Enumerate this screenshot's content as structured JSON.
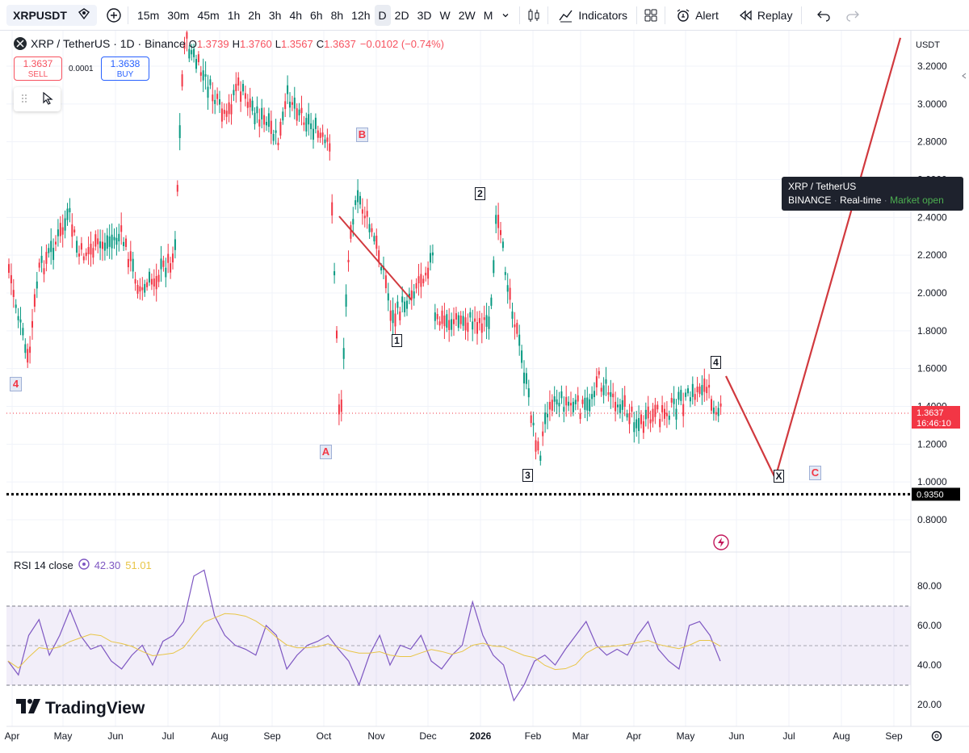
{
  "toolbar": {
    "symbol": "XRPUSDT",
    "intervals": [
      "15m",
      "30m",
      "45m",
      "1h",
      "2h",
      "3h",
      "4h",
      "6h",
      "8h",
      "12h",
      "D",
      "2D",
      "3D",
      "W",
      "2W",
      "M"
    ],
    "active_interval": "D",
    "indicators_label": "Indicators",
    "alert_label": "Alert",
    "replay_label": "Replay"
  },
  "legend": {
    "title": "XRP / TetherUS · 1D · Binance",
    "o_label": "O",
    "o_value": "1.3739",
    "h_label": "H",
    "h_value": "1.3760",
    "l_label": "L",
    "l_value": "1.3567",
    "c_label": "C",
    "c_value": "1.3637",
    "change": "−0.0102 (−0.74%)"
  },
  "trade": {
    "sell_price": "1.3637",
    "sell_label": "SELL",
    "buy_price": "1.3638",
    "buy_label": "BUY",
    "spread": "0.0001"
  },
  "tooltip": {
    "line1": "XRP / TetherUS",
    "exchange": "BINANCE",
    "mode": "Real-time",
    "status": "Market open"
  },
  "price_axis": {
    "currency": "USDT",
    "ticks": [
      "3.2000",
      "3.0000",
      "2.8000",
      "2.6000",
      "2.4000",
      "2.2000",
      "2.0000",
      "1.8000",
      "1.6000",
      "1.4000",
      "1.2000",
      "1.0000",
      "0.8000"
    ],
    "last_price": "1.3637",
    "countdown": "16:46:10",
    "level_label": "0.9350"
  },
  "time_axis": [
    "Apr",
    "May",
    "Jun",
    "Jul",
    "Aug",
    "Sep",
    "Oct",
    "Nov",
    "Dec",
    "2026",
    "Feb",
    "Mar",
    "Apr",
    "May",
    "Jun",
    "Jul",
    "Aug",
    "Sep"
  ],
  "rsi": {
    "label": "RSI 14 close",
    "value": "42.30",
    "ma_value": "51.01",
    "ticks": [
      "80.00",
      "60.00",
      "40.00",
      "20.00"
    ]
  },
  "waves": {
    "left4": "4",
    "A": "A",
    "B": "B",
    "C": "C",
    "X": "X",
    "w1": "1",
    "w2": "2",
    "w3": "3",
    "w4": "4"
  },
  "brand": "TradingView",
  "colors": {
    "up": "#089981",
    "down": "#f23645",
    "projection": "#d1393e",
    "rsi": "#7e57c2",
    "rsi_ma": "#e8c547"
  },
  "chart_data": {
    "type": "candlestick",
    "symbol": "XRP / TetherUS",
    "interval": "1D",
    "exchange": "Binance",
    "ylim": [
      0.72,
      3.3
    ],
    "horizontal_level": 0.935,
    "last_price": 1.3637,
    "price_path": [
      {
        "x": "Apr",
        "price": 2.15
      },
      {
        "x": "Apr",
        "price": 1.62
      },
      {
        "x": "Apr",
        "price": 2.1
      },
      {
        "x": "May",
        "price": 2.4
      },
      {
        "x": "May",
        "price": 2.2
      },
      {
        "x": "Jun",
        "price": 2.3
      },
      {
        "x": "Jun",
        "price": 2.15
      },
      {
        "x": "Jun",
        "price": 2.0
      },
      {
        "x": "Jul",
        "price": 2.2
      },
      {
        "x": "Jul",
        "price": 3.35
      },
      {
        "x": "Aug",
        "price": 2.9
      },
      {
        "x": "Aug",
        "price": 3.1
      },
      {
        "x": "Sep",
        "price": 2.8
      },
      {
        "x": "Sep",
        "price": 3.05
      },
      {
        "x": "Oct",
        "price": 2.75
      },
      {
        "x": "Oct",
        "price": 1.26
      },
      {
        "x": "Oct",
        "price": 2.35
      },
      {
        "x": "Oct",
        "price": 2.5
      },
      {
        "x": "Nov",
        "price": 2.15
      },
      {
        "x": "Nov",
        "price": 1.85
      },
      {
        "x": "Dec",
        "price": 2.2
      },
      {
        "x": "Dec",
        "price": 1.85
      },
      {
        "x": "2026",
        "price": 1.85
      },
      {
        "x": "2026",
        "price": 2.4
      },
      {
        "x": "Jan",
        "price": 1.9
      },
      {
        "x": "Feb",
        "price": 1.12
      },
      {
        "x": "Feb",
        "price": 1.45
      },
      {
        "x": "Mar",
        "price": 1.38
      },
      {
        "x": "Mar",
        "price": 1.55
      },
      {
        "x": "Apr",
        "price": 1.3
      },
      {
        "x": "May",
        "price": 1.45
      },
      {
        "x": "May",
        "price": 1.52
      },
      {
        "x": "May",
        "price": 1.3637
      }
    ],
    "projection": [
      {
        "x": "May",
        "price": 1.56
      },
      {
        "x": "Jun",
        "price": 1.02
      },
      {
        "x": "Sep",
        "price": 3.35
      }
    ],
    "rsi_series": [
      42,
      35,
      55,
      63,
      45,
      55,
      68,
      55,
      48,
      50,
      42,
      38,
      45,
      50,
      40,
      52,
      55,
      62,
      85,
      88,
      65,
      55,
      50,
      48,
      45,
      60,
      55,
      38,
      45,
      50,
      52,
      55,
      48,
      42,
      30,
      45,
      55,
      40,
      50,
      48,
      55,
      42,
      38,
      45,
      50,
      72,
      55,
      45,
      40,
      22,
      30,
      42,
      45,
      40,
      48,
      55,
      62,
      50,
      45,
      48,
      45,
      55,
      62,
      48,
      42,
      38,
      60,
      62,
      55,
      42
    ]
  }
}
